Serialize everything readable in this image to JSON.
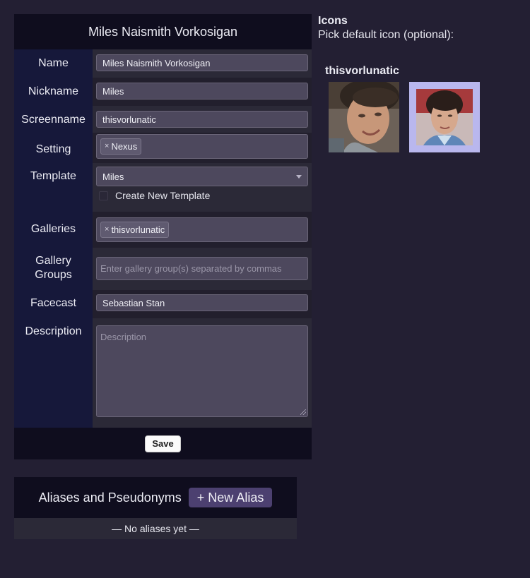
{
  "form": {
    "title": "Miles Naismith Vorkosigan",
    "name_label": "Name",
    "name_value": "Miles Naismith Vorkosigan",
    "nickname_label": "Nickname",
    "nickname_value": "Miles",
    "screenname_label": "Screenname",
    "screenname_value": "thisvorlunatic",
    "setting_label": "Setting",
    "setting_tags": [
      "Nexus"
    ],
    "template_label": "Template",
    "template_value": "Miles",
    "create_template_label": "Create New Template",
    "galleries_label": "Galleries",
    "gallery_tags": [
      "thisvorlunatic"
    ],
    "gallery_groups_label": "Gallery Groups",
    "gallery_groups_placeholder": "Enter gallery group(s) separated by commas",
    "facecast_label": "Facecast",
    "facecast_value": "Sebastian Stan",
    "description_label": "Description",
    "description_placeholder": "Description",
    "save_label": "Save",
    "tag_remove_glyph": "×"
  },
  "aliases": {
    "title": "Aliases and Pseudonyms",
    "new_alias_label": "+ New Alias",
    "empty_text": "— No aliases yet —"
  },
  "icons": {
    "title": "Icons",
    "subtitle": "Pick default icon (optional):",
    "gallery_name": "thisvorlunatic",
    "items": [
      {
        "icon": "portrait-photo",
        "selected": false
      },
      {
        "icon": "portrait-photo",
        "selected": true
      }
    ],
    "selected_border_color": "#b9b7ee"
  }
}
